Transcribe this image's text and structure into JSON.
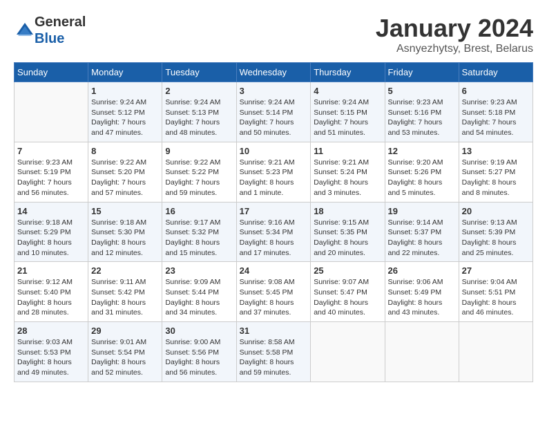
{
  "logo": {
    "general": "General",
    "blue": "Blue"
  },
  "header": {
    "title": "January 2024",
    "subtitle": "Asnyezhytsy, Brest, Belarus"
  },
  "weekdays": [
    "Sunday",
    "Monday",
    "Tuesday",
    "Wednesday",
    "Thursday",
    "Friday",
    "Saturday"
  ],
  "weeks": [
    [
      {
        "day": "",
        "info": ""
      },
      {
        "day": "1",
        "info": "Sunrise: 9:24 AM\nSunset: 5:12 PM\nDaylight: 7 hours\nand 47 minutes."
      },
      {
        "day": "2",
        "info": "Sunrise: 9:24 AM\nSunset: 5:13 PM\nDaylight: 7 hours\nand 48 minutes."
      },
      {
        "day": "3",
        "info": "Sunrise: 9:24 AM\nSunset: 5:14 PM\nDaylight: 7 hours\nand 50 minutes."
      },
      {
        "day": "4",
        "info": "Sunrise: 9:24 AM\nSunset: 5:15 PM\nDaylight: 7 hours\nand 51 minutes."
      },
      {
        "day": "5",
        "info": "Sunrise: 9:23 AM\nSunset: 5:16 PM\nDaylight: 7 hours\nand 53 minutes."
      },
      {
        "day": "6",
        "info": "Sunrise: 9:23 AM\nSunset: 5:18 PM\nDaylight: 7 hours\nand 54 minutes."
      }
    ],
    [
      {
        "day": "7",
        "info": "Sunrise: 9:23 AM\nSunset: 5:19 PM\nDaylight: 7 hours\nand 56 minutes."
      },
      {
        "day": "8",
        "info": "Sunrise: 9:22 AM\nSunset: 5:20 PM\nDaylight: 7 hours\nand 57 minutes."
      },
      {
        "day": "9",
        "info": "Sunrise: 9:22 AM\nSunset: 5:22 PM\nDaylight: 7 hours\nand 59 minutes."
      },
      {
        "day": "10",
        "info": "Sunrise: 9:21 AM\nSunset: 5:23 PM\nDaylight: 8 hours\nand 1 minute."
      },
      {
        "day": "11",
        "info": "Sunrise: 9:21 AM\nSunset: 5:24 PM\nDaylight: 8 hours\nand 3 minutes."
      },
      {
        "day": "12",
        "info": "Sunrise: 9:20 AM\nSunset: 5:26 PM\nDaylight: 8 hours\nand 5 minutes."
      },
      {
        "day": "13",
        "info": "Sunrise: 9:19 AM\nSunset: 5:27 PM\nDaylight: 8 hours\nand 8 minutes."
      }
    ],
    [
      {
        "day": "14",
        "info": "Sunrise: 9:18 AM\nSunset: 5:29 PM\nDaylight: 8 hours\nand 10 minutes."
      },
      {
        "day": "15",
        "info": "Sunrise: 9:18 AM\nSunset: 5:30 PM\nDaylight: 8 hours\nand 12 minutes."
      },
      {
        "day": "16",
        "info": "Sunrise: 9:17 AM\nSunset: 5:32 PM\nDaylight: 8 hours\nand 15 minutes."
      },
      {
        "day": "17",
        "info": "Sunrise: 9:16 AM\nSunset: 5:34 PM\nDaylight: 8 hours\nand 17 minutes."
      },
      {
        "day": "18",
        "info": "Sunrise: 9:15 AM\nSunset: 5:35 PM\nDaylight: 8 hours\nand 20 minutes."
      },
      {
        "day": "19",
        "info": "Sunrise: 9:14 AM\nSunset: 5:37 PM\nDaylight: 8 hours\nand 22 minutes."
      },
      {
        "day": "20",
        "info": "Sunrise: 9:13 AM\nSunset: 5:39 PM\nDaylight: 8 hours\nand 25 minutes."
      }
    ],
    [
      {
        "day": "21",
        "info": "Sunrise: 9:12 AM\nSunset: 5:40 PM\nDaylight: 8 hours\nand 28 minutes."
      },
      {
        "day": "22",
        "info": "Sunrise: 9:11 AM\nSunset: 5:42 PM\nDaylight: 8 hours\nand 31 minutes."
      },
      {
        "day": "23",
        "info": "Sunrise: 9:09 AM\nSunset: 5:44 PM\nDaylight: 8 hours\nand 34 minutes."
      },
      {
        "day": "24",
        "info": "Sunrise: 9:08 AM\nSunset: 5:45 PM\nDaylight: 8 hours\nand 37 minutes."
      },
      {
        "day": "25",
        "info": "Sunrise: 9:07 AM\nSunset: 5:47 PM\nDaylight: 8 hours\nand 40 minutes."
      },
      {
        "day": "26",
        "info": "Sunrise: 9:06 AM\nSunset: 5:49 PM\nDaylight: 8 hours\nand 43 minutes."
      },
      {
        "day": "27",
        "info": "Sunrise: 9:04 AM\nSunset: 5:51 PM\nDaylight: 8 hours\nand 46 minutes."
      }
    ],
    [
      {
        "day": "28",
        "info": "Sunrise: 9:03 AM\nSunset: 5:53 PM\nDaylight: 8 hours\nand 49 minutes."
      },
      {
        "day": "29",
        "info": "Sunrise: 9:01 AM\nSunset: 5:54 PM\nDaylight: 8 hours\nand 52 minutes."
      },
      {
        "day": "30",
        "info": "Sunrise: 9:00 AM\nSunset: 5:56 PM\nDaylight: 8 hours\nand 56 minutes."
      },
      {
        "day": "31",
        "info": "Sunrise: 8:58 AM\nSunset: 5:58 PM\nDaylight: 8 hours\nand 59 minutes."
      },
      {
        "day": "",
        "info": ""
      },
      {
        "day": "",
        "info": ""
      },
      {
        "day": "",
        "info": ""
      }
    ]
  ]
}
